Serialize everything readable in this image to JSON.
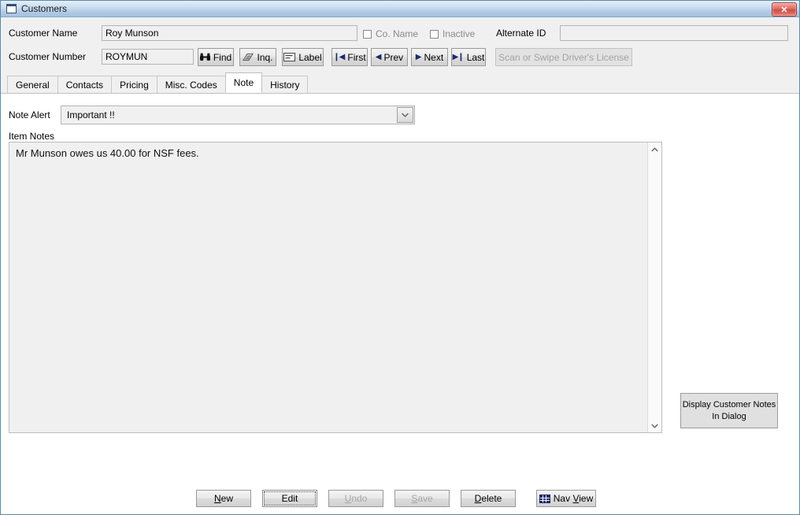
{
  "window": {
    "title": "Customers",
    "icon": "window-icon",
    "close_label": "✕"
  },
  "header": {
    "customer_name_label": "Customer Name",
    "customer_name_value": "Roy Munson",
    "customer_number_label": "Customer Number",
    "customer_number_value": "ROYMUN",
    "co_name_label": "Co. Name",
    "inactive_label": "Inactive",
    "alternate_id_label": "Alternate ID",
    "alternate_id_value": "",
    "buttons": {
      "find": "Find",
      "inq": "Inq.",
      "label": "Label",
      "first": "First",
      "prev": "Prev",
      "next": "Next",
      "last": "Last",
      "scan": "Scan or Swipe Driver's License"
    }
  },
  "tabs": [
    {
      "label": "General",
      "active": false
    },
    {
      "label": "Contacts",
      "active": false
    },
    {
      "label": "Pricing",
      "active": false
    },
    {
      "label": "Misc. Codes",
      "active": false
    },
    {
      "label": "Note",
      "active": true
    },
    {
      "label": "History",
      "active": false
    }
  ],
  "note_tab": {
    "note_alert_label": "Note Alert",
    "note_alert_value": "Important !!",
    "item_notes_label": "Item Notes",
    "item_notes_value": "Mr Munson owes us 40.00 for NSF fees.",
    "display_notes_button_line1": "Display Customer Notes",
    "display_notes_button_line2": "In Dialog"
  },
  "footer": {
    "new": "New",
    "edit": "Edit",
    "undo": "Undo",
    "save": "Save",
    "delete": "Delete",
    "nav_view": "Nav View"
  },
  "colors": {
    "titlebar_top": "#e4eef8",
    "titlebar_bottom": "#a4c1dd",
    "close_red": "#cf4c44",
    "header_bg": "#f0f0f0",
    "panel_bg": "#ffffff",
    "nav_glyph": "#1b2a6b",
    "frame_border": "#5a8ba8"
  }
}
